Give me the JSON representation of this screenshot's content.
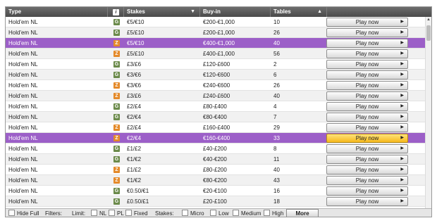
{
  "header": {
    "type": "Type",
    "info_icon": "i",
    "stakes": "Stakes",
    "stakes_sort": "▼",
    "buyin": "Buy-in",
    "tables": "Tables",
    "tables_sort": "▲"
  },
  "rows": [
    {
      "type": "Hold'em NL",
      "game": "NL",
      "icon": "G",
      "stakes": "€5/€10",
      "buyin": "€200-€1,000",
      "tables": "10",
      "play": "Play now",
      "tri": "▶"
    },
    {
      "type": "Hold'em NL",
      "game": "NL",
      "icon": "G",
      "stakes": "£5/£10",
      "buyin": "£200-£1,000",
      "tables": "26",
      "play": "Play now",
      "tri": "▶"
    },
    {
      "type": "Hold'em NL",
      "game": "Z",
      "icon": "Z",
      "stakes": "€5/€10",
      "buyin": "€400-€1,000",
      "tables": "40",
      "play": "Play now",
      "tri": "▶"
    },
    {
      "type": "Hold'em NL",
      "game": "Z",
      "icon": "Z",
      "stakes": "£5/£10",
      "buyin": "£400-£1,000",
      "tables": "56",
      "play": "Play now",
      "tri": "▶"
    },
    {
      "type": "Hold'em NL",
      "game": "NL",
      "icon": "G",
      "stakes": "£3/£6",
      "buyin": "£120-£600",
      "tables": "2",
      "play": "Play now",
      "tri": "▶"
    },
    {
      "type": "Hold'em NL",
      "game": "NL",
      "icon": "G",
      "stakes": "€3/€6",
      "buyin": "€120-€600",
      "tables": "6",
      "play": "Play now",
      "tri": "▶"
    },
    {
      "type": "Hold'em NL",
      "game": "Z",
      "icon": "Z",
      "stakes": "€3/€6",
      "buyin": "€240-€600",
      "tables": "26",
      "play": "Play now",
      "tri": "▶"
    },
    {
      "type": "Hold'em NL",
      "game": "Z",
      "icon": "Z",
      "stakes": "£3/£6",
      "buyin": "£240-£600",
      "tables": "40",
      "play": "Play now",
      "tri": "▶"
    },
    {
      "type": "Hold'em NL",
      "game": "NL",
      "icon": "G",
      "stakes": "£2/£4",
      "buyin": "£80-£400",
      "tables": "4",
      "play": "Play now",
      "tri": "▶"
    },
    {
      "type": "Hold'em NL",
      "game": "NL",
      "icon": "G",
      "stakes": "€2/€4",
      "buyin": "€80-€400",
      "tables": "7",
      "play": "Play now",
      "tri": "▶"
    },
    {
      "type": "Hold'em NL",
      "game": "Z",
      "icon": "Z",
      "stakes": "£2/£4",
      "buyin": "£160-£400",
      "tables": "29",
      "play": "Play now",
      "tri": "▶"
    },
    {
      "type": "Hold'em NL",
      "game": "Z",
      "icon": "Z",
      "stakes": "€2/€4",
      "buyin": "€160-€400",
      "tables": "33",
      "play": "Play now",
      "tri": "▶"
    },
    {
      "type": "Hold'em NL",
      "game": "NL",
      "icon": "G",
      "stakes": "£1/£2",
      "buyin": "£40-£200",
      "tables": "8",
      "play": "Play now",
      "tri": "▶"
    },
    {
      "type": "Hold'em NL",
      "game": "NL",
      "icon": "G",
      "stakes": "€1/€2",
      "buyin": "€40-€200",
      "tables": "11",
      "play": "Play now",
      "tri": "▶"
    },
    {
      "type": "Hold'em NL",
      "game": "Z",
      "icon": "Z",
      "stakes": "£1/£2",
      "buyin": "£80-£200",
      "tables": "40",
      "play": "Play now",
      "tri": "▶"
    },
    {
      "type": "Hold'em NL",
      "game": "Z",
      "icon": "Z",
      "stakes": "€1/€2",
      "buyin": "€80-€200",
      "tables": "43",
      "play": "Play now",
      "tri": "▶"
    },
    {
      "type": "Hold'em NL",
      "game": "NL",
      "icon": "G",
      "stakes": "€0.50/€1",
      "buyin": "€20-€100",
      "tables": "16",
      "play": "Play now",
      "tri": "▶"
    },
    {
      "type": "Hold'em NL",
      "game": "NL",
      "icon": "G",
      "stakes": "£0.50/£1",
      "buyin": "£20-£100",
      "tables": "18",
      "play": "Play now",
      "tri": "▶"
    }
  ],
  "selected_rows": [
    2,
    11
  ],
  "highlighted_button_row": 11,
  "colors": {
    "selected": "#9c5fc8",
    "highlight_button": "#f6b91d",
    "zone_icon": "#e48a2a",
    "game_icon": "#6b8a4a"
  },
  "footer": {
    "hide_full": "Hide Full",
    "filters": "Filters:",
    "limit": "Limit:",
    "nl": "NL",
    "pl": "PL",
    "fixed": "Fixed",
    "stakes": "Stakes:",
    "micro": "Micro",
    "low": "Low",
    "medium": "Medium",
    "high": "High",
    "more": "More"
  },
  "scrollbar": {
    "up_arrow": "▲"
  }
}
